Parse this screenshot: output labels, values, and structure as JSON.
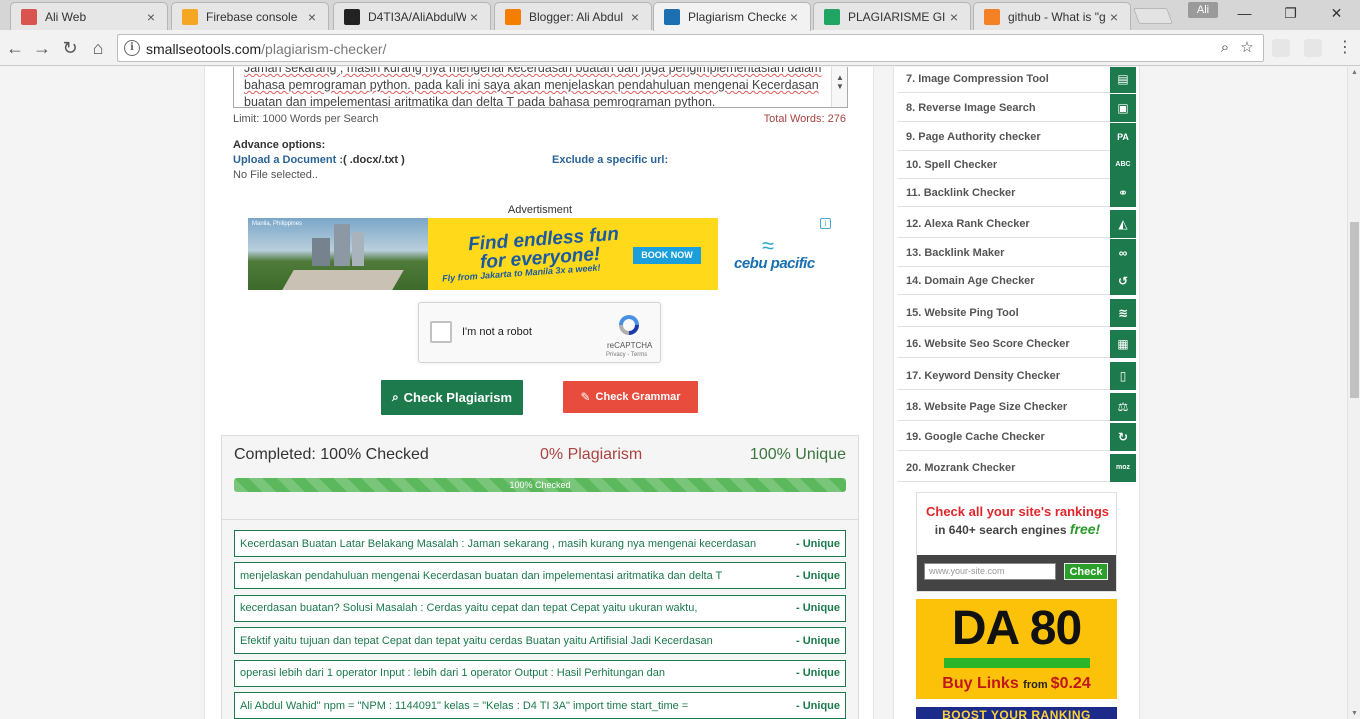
{
  "browser": {
    "tabs": [
      {
        "title": "Ali Web",
        "favicon": "blogger-flag-icon",
        "color": "#d9534f"
      },
      {
        "title": "Firebase console",
        "favicon": "firebase-icon",
        "color": "#f5a623"
      },
      {
        "title": "D4TI3A/AliAbdulW",
        "favicon": "github-icon",
        "color": "#222222"
      },
      {
        "title": "Blogger: Ali Abdul",
        "favicon": "blogger-icon",
        "color": "#f57d00"
      },
      {
        "title": "Plagiarism Checke",
        "favicon": "smallseotools-icon",
        "color": "#1c6fb0"
      },
      {
        "title": "PLAGIARISME GIS",
        "favicon": "google-drive-icon",
        "color": "#1fa463"
      },
      {
        "title": "github - What is \"g",
        "favicon": "stackoverflow-icon",
        "color": "#f48024"
      }
    ],
    "profile_name": "Ali",
    "url_host": "smallseotools.com",
    "url_path": "/plagiarism-checker/"
  },
  "editor": {
    "lines": [
      "Jaman sekarang , masih kurang nya mengenai kecerdasan buatan dan juga pengimplementasian dalam",
      "bahasa pemrograman python. pada kali ini saya akan menjelaskan pendahuluan mengenai Kecerdasan",
      "buatan dan impelementasi aritmatika dan delta T pada bahasa pemrograman python."
    ],
    "limit_text": "Limit: 1000 Words per Search",
    "total_words": "Total Words: 276"
  },
  "advanced": {
    "title": "Advance options:",
    "upload_label": "Upload a Document :",
    "upload_ext": "( .docx/.txt )",
    "exclude_label": "Exclude a specific url:",
    "no_file": "No File selected.."
  },
  "ad": {
    "label": "Advertisment",
    "location": "Manila, Philippines",
    "headline1": "Find endless fun",
    "headline2": "for everyone!",
    "subline": "Fly from Jakarta to Manila 3x a week!",
    "cta": "BOOK NOW",
    "brand": "cebu pacific"
  },
  "captcha": {
    "label": "I'm not a robot",
    "brand": "reCAPTCHA",
    "terms": "Privacy - Terms"
  },
  "buttons": {
    "check": "Check Plagiarism",
    "grammar": "Check Grammar"
  },
  "results": {
    "completed": "Completed: 100% Checked",
    "plagiarism": "0% Plagiarism",
    "unique": "100% Unique",
    "progress_label": "100% Checked",
    "progress_value": 1.0,
    "rows": [
      {
        "text": "Kecerdasan Buatan Latar Belakang Masalah : Jaman sekarang , masih kurang nya mengenai kecerdasan",
        "status": "- Unique"
      },
      {
        "text": "menjelaskan pendahuluan mengenai Kecerdasan buatan dan impelementasi aritmatika dan delta T",
        "status": "- Unique"
      },
      {
        "text": "kecerdasan buatan? Solusi Masalah : Cerdas yaitu cepat dan tepat Cepat yaitu ukuran waktu,",
        "status": "- Unique"
      },
      {
        "text": "Efektif yaitu tujuan dan tepat Cepat dan tepat yaitu cerdas Buatan yaitu Artifisial Jadi Kecerdasan",
        "status": "- Unique"
      },
      {
        "text": "operasi lebih dari 1 operator Input : lebih dari 1 operator Output : Hasil Perhitungan dan",
        "status": "- Unique"
      },
      {
        "text": "Ali Abdul Wahid\" npm = \"NPM : 1144091\" kelas = \"Kelas : D4 TI 3A\" import time start_time =",
        "status": "- Unique"
      }
    ]
  },
  "sidebar": {
    "tools": [
      {
        "label": "7. Image Compression Tool",
        "icon": "image-compress-icon",
        "glyph": "▤"
      },
      {
        "label": "8. Reverse Image Search",
        "icon": "image-icon",
        "glyph": "▣"
      },
      {
        "label": "9. Page Authority checker",
        "icon": "pa-icon",
        "glyph": "PA"
      },
      {
        "label": "10. Spell Checker",
        "icon": "abc-icon",
        "glyph": "ABC"
      },
      {
        "label": "11. Backlink Checker",
        "icon": "link-icon",
        "glyph": "⚭"
      },
      {
        "label": "12. Alexa Rank Checker",
        "icon": "area-chart-icon",
        "glyph": "◭"
      },
      {
        "label": "13. Backlink Maker",
        "icon": "chain-icon",
        "glyph": "∞"
      },
      {
        "label": "14. Domain Age Checker",
        "icon": "history-icon",
        "glyph": "↺"
      },
      {
        "label": "15. Website Ping Tool",
        "icon": "rss-icon",
        "glyph": "≋"
      },
      {
        "label": "16. Website Seo Score Checker",
        "icon": "calculator-icon",
        "glyph": "▦"
      },
      {
        "label": "17. Keyword Density Checker",
        "icon": "document-icon",
        "glyph": "▯"
      },
      {
        "label": "18. Website Page Size Checker",
        "icon": "balance-scale-icon",
        "glyph": "⚖"
      },
      {
        "label": "19. Google Cache Checker",
        "icon": "refresh-icon",
        "glyph": "↻"
      },
      {
        "label": "20. Mozrank Checker",
        "icon": "moz-icon",
        "glyph": "moz"
      }
    ]
  },
  "promos": {
    "rank_line1": "Check all your site's rankings",
    "rank_line2_pre": "in 640+ search engines ",
    "rank_line2_free": "free!",
    "rank_placeholder": "www.your-site.com",
    "rank_button": "Check",
    "da_text": "DA 80",
    "da_buy": "Buy Links ",
    "da_from": "from ",
    "da_price": "$0.24",
    "boost": "BOOST YOUR RANKING"
  }
}
